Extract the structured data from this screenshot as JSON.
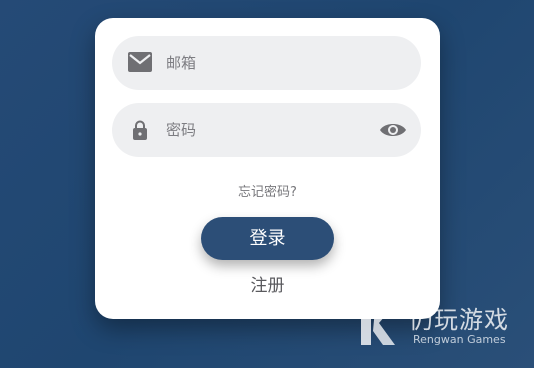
{
  "login_form": {
    "email_placeholder": "邮箱",
    "password_placeholder": "密码",
    "forgot_password": "忘记密码?",
    "login_button": "登录",
    "register_link": "注册"
  },
  "watermark": {
    "title": "仍玩游戏",
    "subtitle": "Rengwan Games"
  },
  "icons": {
    "email": "mail-icon",
    "password": "lock-icon",
    "toggle_visibility": "eye-icon"
  },
  "colors": {
    "background": "#234a74",
    "card": "#ffffff",
    "field": "#eeeff1",
    "button": "#2c4e77"
  }
}
